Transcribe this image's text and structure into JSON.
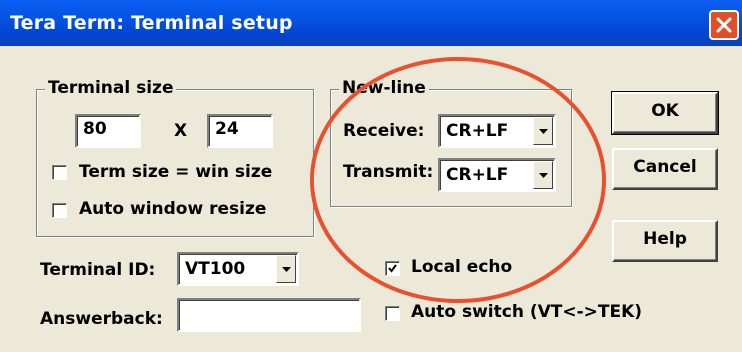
{
  "window": {
    "title": "Tera Term: Terminal setup"
  },
  "terminal_size": {
    "legend": "Terminal size",
    "columns": "80",
    "separator": "X",
    "rows": "24",
    "term_size_eq_win_size": {
      "label": "Term size = win size",
      "checked": false
    },
    "auto_window_resize": {
      "label": "Auto window resize",
      "checked": false
    }
  },
  "new_line": {
    "legend": "New-line",
    "receive_label": "Receive:",
    "receive_value": "CR+LF",
    "transmit_label": "Transmit:",
    "transmit_value": "CR+LF"
  },
  "terminal_id": {
    "label": "Terminal ID:",
    "value": "VT100"
  },
  "answerback": {
    "label": "Answerback:",
    "value": ""
  },
  "local_echo": {
    "label": "Local echo",
    "checked": true
  },
  "auto_switch": {
    "label": "Auto switch (VT<->TEK)",
    "checked": false
  },
  "buttons": {
    "ok": "OK",
    "cancel": "Cancel",
    "help": "Help"
  },
  "annotation": {
    "color": "#e8502f",
    "shape": "ellipse"
  }
}
